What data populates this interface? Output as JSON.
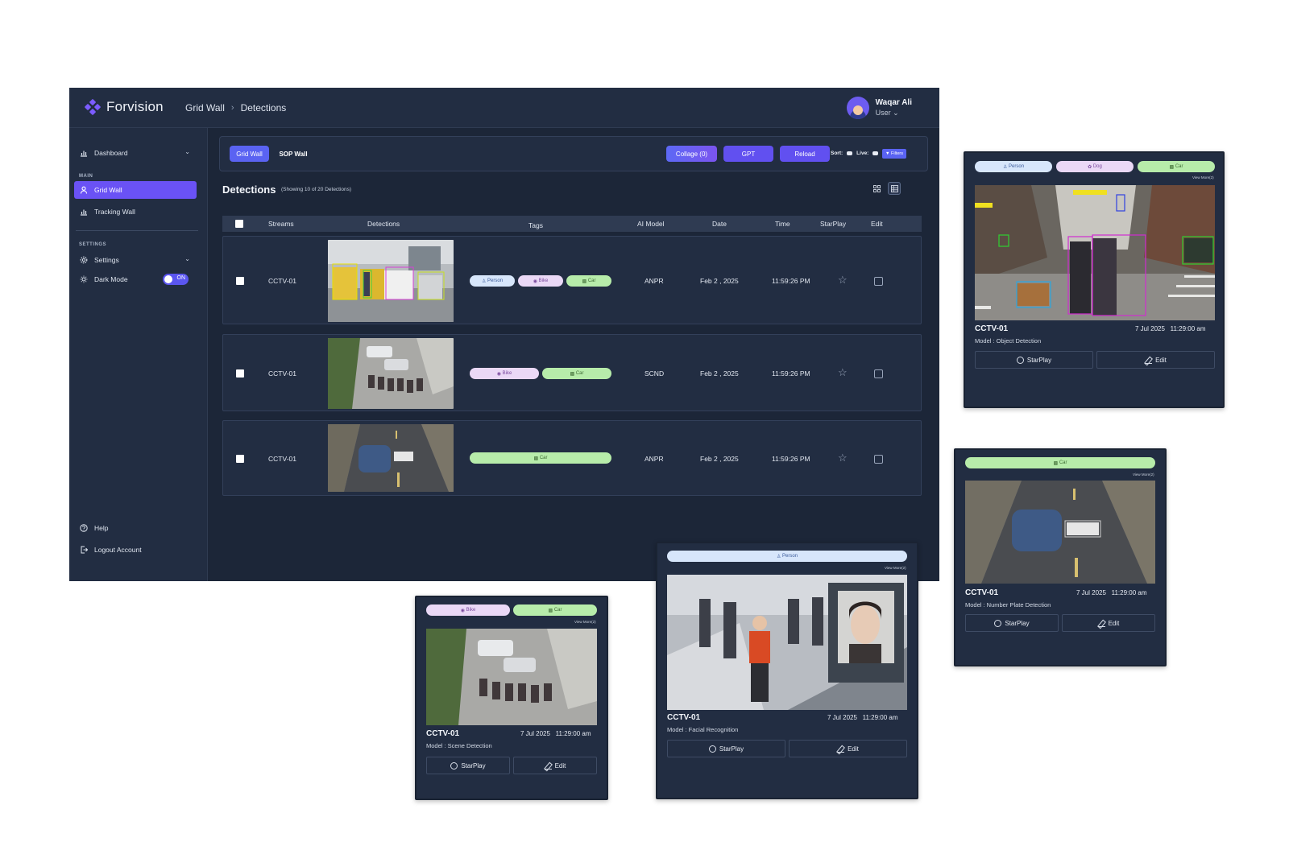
{
  "app": {
    "brand": "Forvision",
    "breadcrumb": [
      "Grid Wall",
      "Detections"
    ],
    "user": {
      "name": "Waqar Ali",
      "role": "User"
    }
  },
  "sidebar": {
    "dashboard": "Dashboard",
    "main_label": "MAIN",
    "grid_wall": "Grid Wall",
    "tracking_wall": "Tracking Wall",
    "settings_label": "SETTINGS",
    "settings": "Settings",
    "dark_mode": "Dark Mode",
    "dark_mode_state": "ON",
    "help": "Help",
    "logout": "Logout Account"
  },
  "toolbar": {
    "tab_grid": "Grid Wall",
    "tab_sop": "SOP Wall",
    "collage": "Collage (0)",
    "gpt": "GPT",
    "reload": "Reload",
    "sort": "Sort:",
    "live": "Live:",
    "filters": "Filters"
  },
  "detections": {
    "title": "Detections",
    "subtitle": "(Showing 10 of 20 Detections)",
    "columns": [
      "Streams",
      "Detections",
      "Tags",
      "AI Model",
      "Date",
      "Time",
      "StarPlay",
      "Edit"
    ],
    "rows": [
      {
        "stream": "CCTV-01",
        "tags": [
          "Person",
          "Bike",
          "Car"
        ],
        "model": "ANPR",
        "date": "Feb 2 , 2025",
        "time": "11:59:26 PM"
      },
      {
        "stream": "CCTV-01",
        "tags": [
          "Bike",
          "Car"
        ],
        "model": "SCND",
        "date": "Feb 2 , 2025",
        "time": "11:59:26 PM"
      },
      {
        "stream": "CCTV-01",
        "tags": [
          "Car"
        ],
        "model": "ANPR",
        "date": "Feb 2 , 2025",
        "time": "11:59:26 PM"
      }
    ]
  },
  "cards": [
    {
      "tags": [
        "Person",
        "Dog",
        "Car"
      ],
      "view_more": "View More(2)",
      "title": "CCTV-01",
      "date": "7 Jul 2025",
      "time": "11:29:00 am",
      "model": "Model : Object Detection",
      "starplay": "StarPlay",
      "edit": "Edit"
    },
    {
      "tags": [
        "Car"
      ],
      "view_more": "View More(2)",
      "title": "CCTV-01",
      "date": "7 Jul 2025",
      "time": "11:29:00 am",
      "model": "Model : Number Plate Detection",
      "starplay": "StarPlay",
      "edit": "Edit"
    },
    {
      "tags": [
        "Person"
      ],
      "view_more": "View More(2)",
      "title": "CCTV-01",
      "date": "7 Jul 2025",
      "time": "11:29:00 am",
      "model": "Model : Facial Recognition",
      "starplay": "StarPlay",
      "edit": "Edit"
    },
    {
      "tags": [
        "Bike",
        "Car"
      ],
      "view_more": "View More(2)",
      "title": "CCTV-01",
      "date": "7 Jul 2025",
      "time": "11:29:00 am",
      "model": "Model : Scene Detection",
      "starplay": "StarPlay",
      "edit": "Edit"
    }
  ],
  "colors": {
    "accent": "#6a52f5",
    "background": "#1c2638",
    "panel": "#222d42",
    "tag_person": "#d7e6fb",
    "tag_bike": "#ead8f6",
    "tag_car": "#b7ecaa"
  }
}
